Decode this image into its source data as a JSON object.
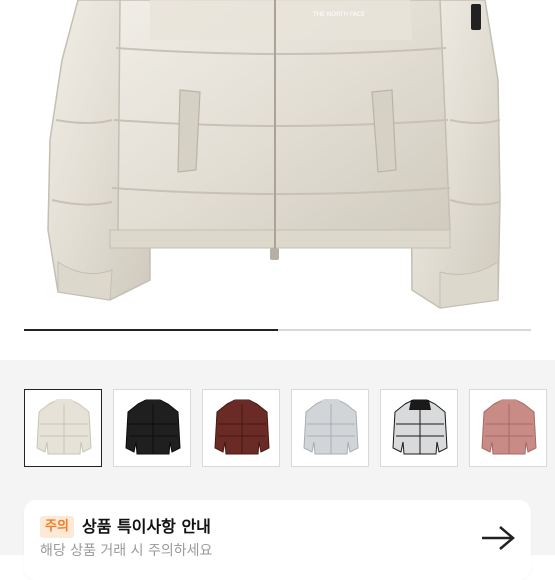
{
  "hero": {
    "brand_text": "THE NORTH FACE",
    "carousel_progress": 0.5
  },
  "thumbnails": [
    {
      "color_name": "ivory",
      "body_color": "#e6e2d7",
      "shade_color": "#c9c4b7",
      "selected": true
    },
    {
      "color_name": "black",
      "body_color": "#1f1f1f",
      "shade_color": "#0c0c0c",
      "selected": false
    },
    {
      "color_name": "burgundy",
      "body_color": "#6a2b27",
      "shade_color": "#45190f",
      "selected": false
    },
    {
      "color_name": "light-grey",
      "body_color": "#d2d5d8",
      "shade_color": "#a9adb2",
      "selected": false
    },
    {
      "color_name": "silver-black",
      "body_color": "#d9dadc",
      "shade_color": "#1a1a1a",
      "selected": false
    },
    {
      "color_name": "pink",
      "body_color": "#c98b86",
      "shade_color": "#a66a64",
      "selected": false
    }
  ],
  "notice": {
    "badge": "주의",
    "title": "상품 특이사항 안내",
    "subtitle": "해당 상품 거래 시 주의하세요",
    "arrow_icon": "arrow-right-icon"
  }
}
